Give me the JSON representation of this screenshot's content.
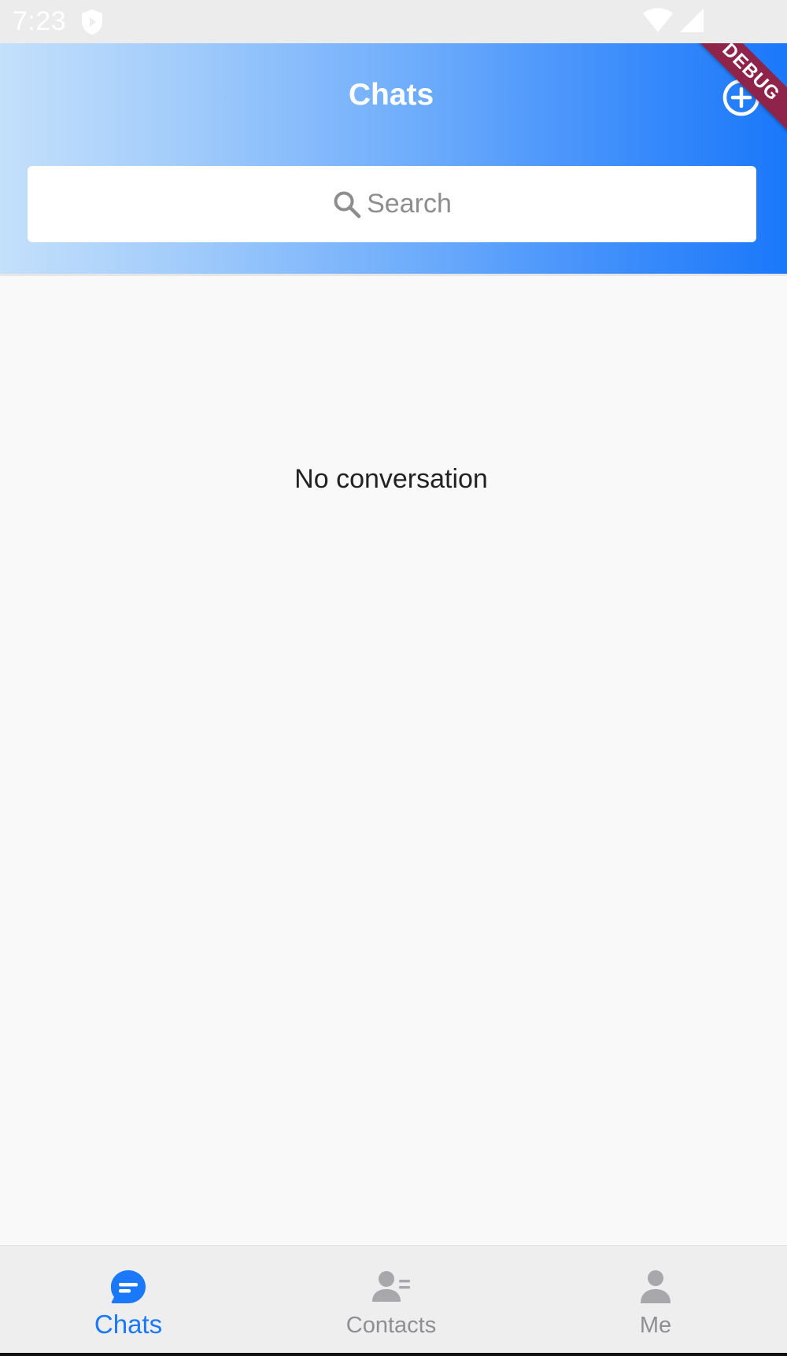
{
  "status_bar": {
    "time": "7:23"
  },
  "header": {
    "title": "Chats",
    "debug_label": "DEBUG",
    "search": {
      "placeholder": "Search"
    }
  },
  "main": {
    "empty_message": "No conversation"
  },
  "bottom_nav": {
    "items": [
      {
        "label": "Chats",
        "icon": "chat-bubble-icon",
        "active": true
      },
      {
        "label": "Contacts",
        "icon": "contacts-icon",
        "active": false
      },
      {
        "label": "Me",
        "icon": "person-icon",
        "active": false
      }
    ]
  },
  "colors": {
    "accent": "#1a78fa",
    "inactive": "#8e8e93",
    "debug_banner": "#8e2449"
  }
}
